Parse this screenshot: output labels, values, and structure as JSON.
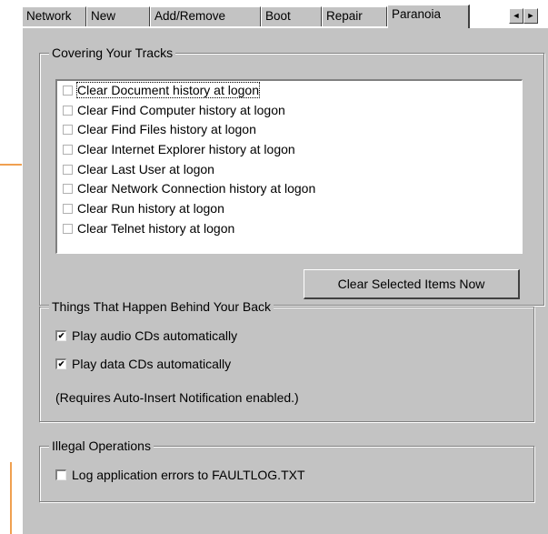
{
  "tabs": [
    {
      "label": "Network"
    },
    {
      "label": "New"
    },
    {
      "label": "Add/Remove"
    },
    {
      "label": "Boot"
    },
    {
      "label": "Repair"
    },
    {
      "label": "Paranoia",
      "active": true
    }
  ],
  "tab_scroll": {
    "left": "◄",
    "right": "►"
  },
  "tracks": {
    "title": "Covering Your Tracks",
    "items": [
      {
        "label": "Clear Document history at logon",
        "checked": false
      },
      {
        "label": "Clear Find Computer history at logon",
        "checked": false
      },
      {
        "label": "Clear Find Files history at logon",
        "checked": false
      },
      {
        "label": "Clear Internet Explorer history at logon",
        "checked": false
      },
      {
        "label": "Clear Last User at logon",
        "checked": false
      },
      {
        "label": "Clear Network Connection history at logon",
        "checked": false
      },
      {
        "label": "Clear Run history at logon",
        "checked": false
      },
      {
        "label": "Clear Telnet history at logon",
        "checked": false
      }
    ],
    "button_label": "Clear Selected Items Now"
  },
  "behind": {
    "title": "Things That Happen Behind Your Back",
    "audio_label": "Play audio CDs automatically",
    "audio_checked": true,
    "data_label": "Play data CDs automatically",
    "data_checked": true,
    "note": "(Requires Auto-Insert Notification enabled.)"
  },
  "illegal": {
    "title": "Illegal Operations",
    "log_label": "Log application errors to FAULTLOG.TXT",
    "log_checked": false
  },
  "check_mark": "✔",
  "colors": {
    "face": "#c3c3c3",
    "accent": "#f0a050",
    "shadow": "#808080"
  }
}
